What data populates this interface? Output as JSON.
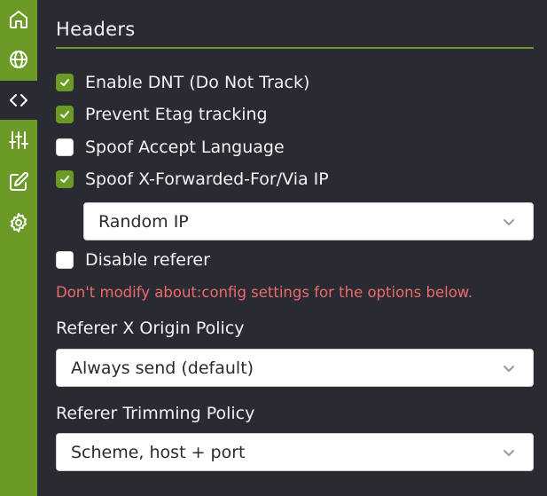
{
  "sidebar": {
    "items": [
      {
        "icon": "home-icon",
        "active": false
      },
      {
        "icon": "globe-icon",
        "active": false
      },
      {
        "icon": "code-icon",
        "active": true
      },
      {
        "icon": "sliders-icon",
        "active": false
      },
      {
        "icon": "edit-icon",
        "active": false
      },
      {
        "icon": "gear-icon",
        "active": false
      }
    ]
  },
  "colors": {
    "accent": "#6b9a26",
    "background": "#2a2a33",
    "warning": "#ec6a6a"
  },
  "section": {
    "title": "Headers"
  },
  "options": {
    "dnt": {
      "label": "Enable DNT (Do Not Track)",
      "checked": true
    },
    "etag": {
      "label": "Prevent Etag tracking",
      "checked": true
    },
    "accept_language": {
      "label": "Spoof Accept Language",
      "checked": false
    },
    "xff": {
      "label": "Spoof X-Forwarded-For/Via IP",
      "checked": true
    },
    "xff_select": {
      "value": "Random IP"
    },
    "disable_referer": {
      "label": "Disable referer",
      "checked": false
    }
  },
  "warning": "Don't modify about:config settings for the options below.",
  "referer_x_origin": {
    "label": "Referer X Origin Policy",
    "value": "Always send (default)"
  },
  "referer_trimming": {
    "label": "Referer Trimming Policy",
    "value": "Scheme, host + port"
  }
}
